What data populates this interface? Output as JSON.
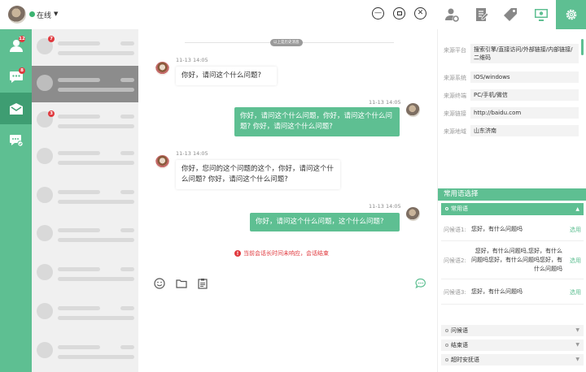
{
  "header": {
    "status": "在线"
  },
  "nav": {
    "badges": [
      "12",
      "8",
      "7",
      "3"
    ]
  },
  "chat": {
    "history_label": "以上是历史消息",
    "messages": [
      {
        "time": "11-13 14:05",
        "direction": "in",
        "text": "你好，请问这个什么问题?"
      },
      {
        "time": "11-13 14:05",
        "direction": "out",
        "text": "你好，请问这个什么问题，你好，请问这个什么问题? 你好，请问这个什么问题?"
      },
      {
        "time": "11-13 14:05",
        "direction": "in",
        "text": "你好，您问的这个问题的这个，你好，请问这个什么问题? 你好，请问这个什么问题?"
      },
      {
        "time": "11-13 14:05",
        "direction": "out",
        "text": "你好，请问这个什么问题，这个什么问题?"
      }
    ],
    "session_warning": "当前会话长时间未响应，会话结束"
  },
  "info": {
    "rows": [
      {
        "label": "来源平台",
        "value": "搜索引擎/直接访问/外部链接/内部链接/二维码"
      },
      {
        "label": "来源系统",
        "value": "IOS/windows"
      },
      {
        "label": "来源终端",
        "value": "PC/手机/微信"
      },
      {
        "label": "来源链接",
        "value": "http://baidu.com"
      },
      {
        "label": "来源地域",
        "value": "山东济南"
      }
    ]
  },
  "phrases": {
    "header": "常用语选择",
    "active_category": "常用语",
    "items": [
      {
        "label": "问候语1:",
        "text": "您好，有什么问题吗",
        "action": "选用"
      },
      {
        "label": "问候语2:",
        "text": "您好，有什么问题吗,您好，有什么问题吗您好，有什么问题吗您好，有什么问题吗",
        "action": "选用"
      },
      {
        "label": "问候语3:",
        "text": "您好，有什么问题吗",
        "action": "选用"
      }
    ],
    "categories": [
      "问候语",
      "结束语",
      "超时安抚语"
    ]
  },
  "colors": {
    "accent": "#5ebf92",
    "accent_dark": "#3e9d72",
    "badge": "#e0393e"
  }
}
